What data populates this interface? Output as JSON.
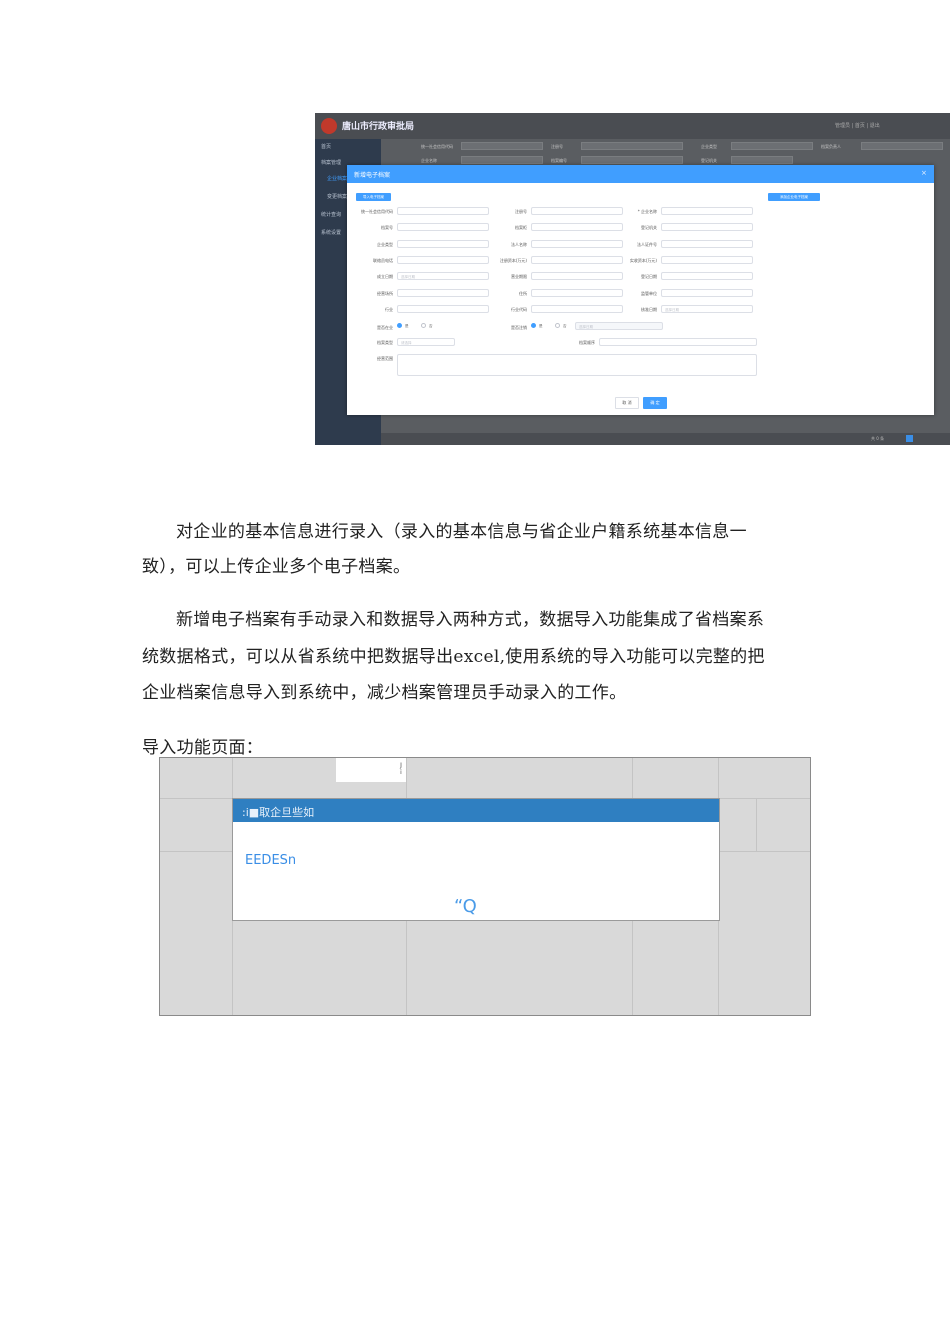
{
  "screenshot1": {
    "app_title": "唐山市行政审批局",
    "user_area": "管理员 | 首页 | 退出",
    "sidebar": {
      "items": [
        "首页",
        "档案管理",
        "企业档案",
        "变更档案",
        "统计查询",
        "系统设置"
      ]
    },
    "filter_labels": [
      "统一社会信用代码",
      "注册号",
      "企业类型",
      "档案负责人",
      "企业名称",
      "档案编号",
      "登记机关"
    ],
    "pagination": "共 0 条",
    "modal": {
      "title": "新增电子档案",
      "close_icon": "×",
      "import_button": "导入电子档案",
      "upload_button": "添加企业电子档案",
      "fields": [
        [
          "统一社会信用代码",
          "注册号",
          "* 企业名称"
        ],
        [
          "档案号",
          "档案柜",
          "登记机关"
        ],
        [
          "企业类型",
          "法人名称",
          "法人证件号"
        ],
        [
          "联络员电话",
          "注册资本(万元)",
          "实收资本(万元)"
        ],
        [
          "成立日期",
          "营业期限",
          "登记日期"
        ],
        [
          "经营场所",
          "住所",
          "监管单位"
        ],
        [
          "行业",
          "行业代码",
          "核准日期"
        ]
      ],
      "date_placeholder": "选择日期",
      "radio_rows": {
        "first_label": "是否在业",
        "second_label": "是否注销",
        "yes": "是",
        "no": "否",
        "date_placeholder": "选择日期"
      },
      "archive_type_label": "档案类型",
      "archive_type_placeholder": "请选择",
      "archive_order_label": "档案顺序",
      "scope_label": "经营范围",
      "cancel_button": "取 消",
      "confirm_button": "确 定"
    }
  },
  "paragraphs": [
    "对企业的基本信息进行录入（录入的基本信息与省企业户籍系统基本信息一",
    "致），可以上传企业多个电子档案。",
    "新增电子档案有手动录入和数据导入两种方式，数据导入功能集成了省档案系",
    "统数据格式，可以从省系统中把数据导出excel,使用系统的导入功能可以完整的把",
    "企业档案信息导入到系统中，减少档案管理员手动录入的工作。",
    "导入功能页面："
  ],
  "screenshot2": {
    "panel_text": "J\ni",
    "modal_title": ":i■取企旦些如",
    "link_text": "EEDESn",
    "icon_text": "“Q"
  }
}
